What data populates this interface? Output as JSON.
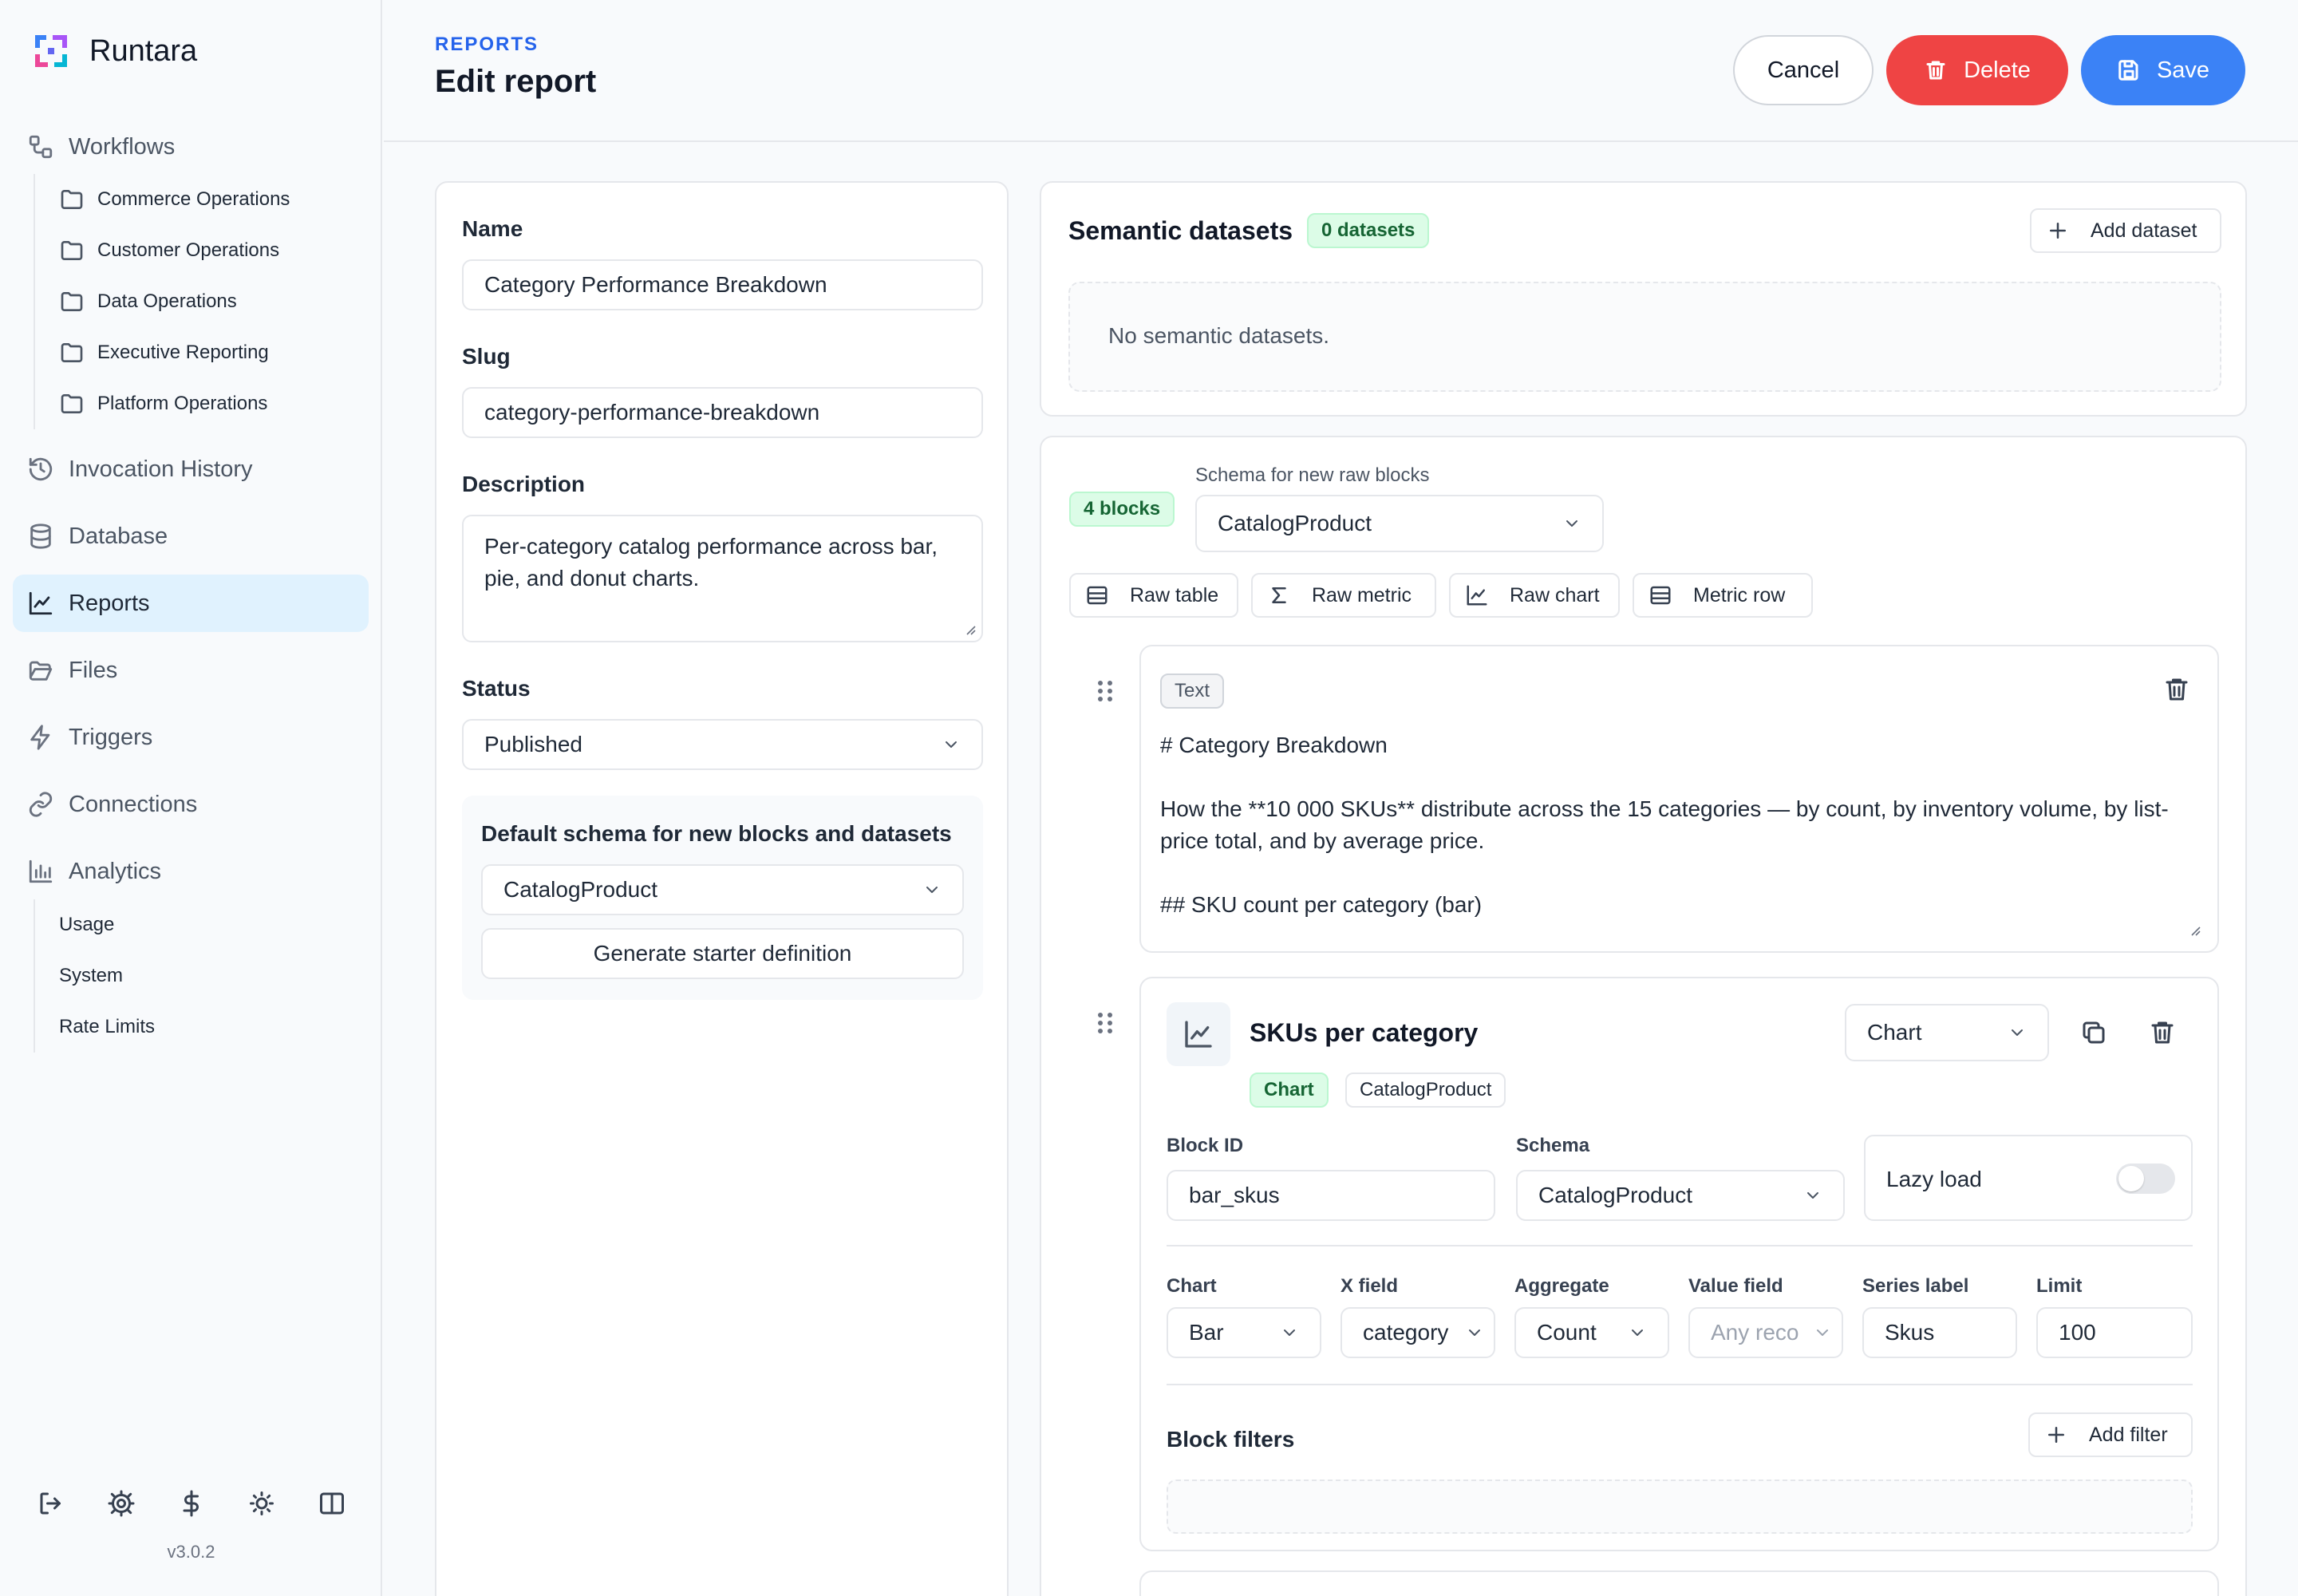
{
  "app": {
    "name": "Runtara",
    "version": "v3.0.2"
  },
  "sidebar": {
    "workflows": {
      "label": "Workflows",
      "folders": [
        "Commerce Operations",
        "Customer Operations",
        "Data Operations",
        "Executive Reporting",
        "Platform Operations"
      ]
    },
    "items": [
      {
        "label": "Invocation History",
        "icon": "history-icon"
      },
      {
        "label": "Database",
        "icon": "database-icon"
      },
      {
        "label": "Reports",
        "icon": "chart-line-icon",
        "active": true
      },
      {
        "label": "Files",
        "icon": "folder-open-icon"
      },
      {
        "label": "Triggers",
        "icon": "bolt-icon"
      },
      {
        "label": "Connections",
        "icon": "link-icon"
      }
    ],
    "analytics": {
      "label": "Analytics",
      "children": [
        "Usage",
        "System",
        "Rate Limits"
      ]
    },
    "footer_icons": [
      "logout-icon",
      "settings-icon",
      "dollar-icon",
      "theme-sun-icon",
      "sidebar-toggle-icon"
    ]
  },
  "header": {
    "eyebrow": "REPORTS",
    "title": "Edit report",
    "cancel_label": "Cancel",
    "delete_label": "Delete",
    "save_label": "Save"
  },
  "form": {
    "name_label": "Name",
    "name_value": "Category Performance Breakdown",
    "slug_label": "Slug",
    "slug_value": "category-performance-breakdown",
    "description_label": "Description",
    "description_value": "Per-category catalog performance across bar, pie, and donut charts.",
    "status_label": "Status",
    "status_value": "Published",
    "default_schema_label": "Default schema for new blocks and datasets",
    "default_schema_value": "CatalogProduct",
    "generate_label": "Generate starter definition"
  },
  "datasets": {
    "title": "Semantic datasets",
    "count_badge": "0 datasets",
    "add_label": "Add dataset",
    "empty_text": "No semantic datasets."
  },
  "blocks": {
    "count_badge": "4 blocks",
    "schema_label": "Schema for new raw blocks",
    "schema_value": "CatalogProduct",
    "tools": [
      {
        "label": "Raw table",
        "icon": "table-icon"
      },
      {
        "label": "Raw metric",
        "icon": "sigma-icon"
      },
      {
        "label": "Raw chart",
        "icon": "chart-icon"
      },
      {
        "label": "Metric row",
        "icon": "table-icon"
      }
    ],
    "text_block": {
      "badge": "Text",
      "line1": "# Category Breakdown",
      "line2": "How the **10 000 SKUs** distribute across the 15 categories — by count, by inventory volume, by list-price total, and by average price.",
      "line3": "## SKU count per category (bar)"
    },
    "chart_block": {
      "title": "SKUs per category",
      "type_badge": "Chart",
      "schema_badge": "CatalogProduct",
      "type_select": "Chart",
      "block_id_label": "Block ID",
      "block_id_value": "bar_skus",
      "schema_label": "Schema",
      "schema_value": "CatalogProduct",
      "lazy_label": "Lazy load",
      "lazy_on": false,
      "chart_label": "Chart",
      "chart_value": "Bar",
      "xfield_label": "X field",
      "xfield_value": "category",
      "aggregate_label": "Aggregate",
      "aggregate_value": "Count",
      "valuefield_label": "Value field",
      "valuefield_placeholder": "Any reco",
      "series_label": "Series label",
      "series_value": "Skus",
      "limit_label": "Limit",
      "limit_value": "100",
      "filters_label": "Block filters",
      "add_filter_label": "Add filter"
    }
  },
  "colors": {
    "accent": "#3b82f6",
    "danger": "#ef4444",
    "eyebrow": "#2563eb",
    "active_nav": "#e0f2fe",
    "badge_green": "#dcfce7"
  }
}
